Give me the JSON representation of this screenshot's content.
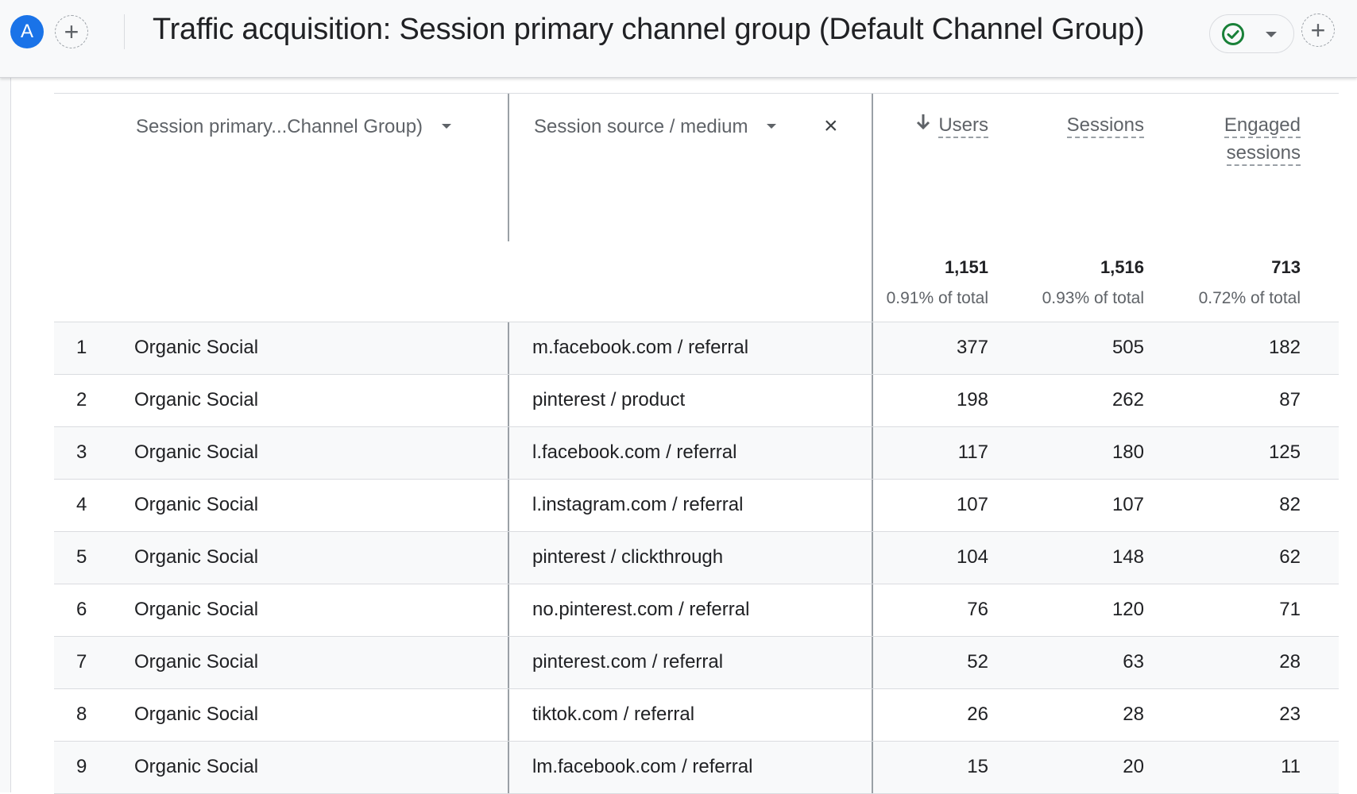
{
  "header": {
    "avatar_letter": "A",
    "title": "Traffic acquisition: Session primary channel group (Default Channel Group)",
    "add_comparison_icon": "plus-icon",
    "status_icon": "check-circle-icon",
    "status_color": "#188038",
    "accent_color": "#1a73e8"
  },
  "table": {
    "dimension_headers": [
      {
        "label": "Session primary...Channel Group)"
      },
      {
        "label": "Session source / medium"
      }
    ],
    "remove_dimension_label": "×",
    "metric_headers": [
      {
        "label": "Users",
        "sorted": "descending"
      },
      {
        "label": "Sessions"
      },
      {
        "label_line1": "Engaged",
        "label_line2": "sessions"
      }
    ],
    "totals": [
      {
        "value": "1,151",
        "pct": "0.91% of total"
      },
      {
        "value": "1,516",
        "pct": "0.93% of total"
      },
      {
        "value": "713",
        "pct": "0.72% of total"
      }
    ],
    "rows": [
      {
        "index": "1",
        "channel": "Organic Social",
        "source_medium": "m.facebook.com / referral",
        "users": "377",
        "sessions": "505",
        "engaged": "182"
      },
      {
        "index": "2",
        "channel": "Organic Social",
        "source_medium": "pinterest / product",
        "users": "198",
        "sessions": "262",
        "engaged": "87"
      },
      {
        "index": "3",
        "channel": "Organic Social",
        "source_medium": "l.facebook.com / referral",
        "users": "117",
        "sessions": "180",
        "engaged": "125"
      },
      {
        "index": "4",
        "channel": "Organic Social",
        "source_medium": "l.instagram.com / referral",
        "users": "107",
        "sessions": "107",
        "engaged": "82"
      },
      {
        "index": "5",
        "channel": "Organic Social",
        "source_medium": "pinterest / clickthrough",
        "users": "104",
        "sessions": "148",
        "engaged": "62"
      },
      {
        "index": "6",
        "channel": "Organic Social",
        "source_medium": "no.pinterest.com / referral",
        "users": "76",
        "sessions": "120",
        "engaged": "71"
      },
      {
        "index": "7",
        "channel": "Organic Social",
        "source_medium": "pinterest.com / referral",
        "users": "52",
        "sessions": "63",
        "engaged": "28"
      },
      {
        "index": "8",
        "channel": "Organic Social",
        "source_medium": "tiktok.com / referral",
        "users": "26",
        "sessions": "28",
        "engaged": "23"
      },
      {
        "index": "9",
        "channel": "Organic Social",
        "source_medium": "lm.facebook.com / referral",
        "users": "15",
        "sessions": "20",
        "engaged": "11"
      }
    ]
  }
}
